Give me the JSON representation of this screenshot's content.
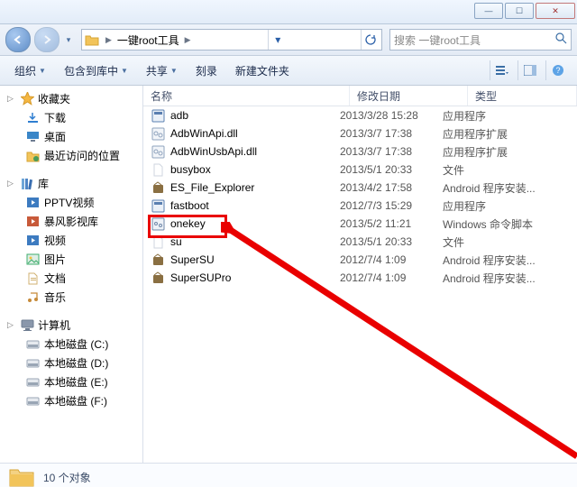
{
  "titlebar": {
    "min": "—",
    "max": "☐",
    "close": "✕"
  },
  "nav": {
    "crumb_text": "一键root工具",
    "search_placeholder": "搜索 一键root工具"
  },
  "toolbar": {
    "organize": "组织",
    "include": "包含到库中",
    "share": "共享",
    "burn": "刻录",
    "newfolder": "新建文件夹"
  },
  "sidebar": {
    "favorites": {
      "label": "收藏夹",
      "items": [
        "下载",
        "桌面",
        "最近访问的位置"
      ]
    },
    "libraries": {
      "label": "库",
      "items": [
        "PPTV视频",
        "暴风影视库",
        "视频",
        "图片",
        "文档",
        "音乐"
      ]
    },
    "computer": {
      "label": "计算机",
      "items": [
        "本地磁盘 (C:)",
        "本地磁盘 (D:)",
        "本地磁盘 (E:)",
        "本地磁盘 (F:)"
      ]
    }
  },
  "columns": {
    "name": "名称",
    "date": "修改日期",
    "type": "类型"
  },
  "files": [
    {
      "name": "adb",
      "date": "2013/3/28 15:28",
      "type": "应用程序",
      "icon": "exe"
    },
    {
      "name": "AdbWinApi.dll",
      "date": "2013/3/7 17:38",
      "type": "应用程序扩展",
      "icon": "dll"
    },
    {
      "name": "AdbWinUsbApi.dll",
      "date": "2013/3/7 17:38",
      "type": "应用程序扩展",
      "icon": "dll"
    },
    {
      "name": "busybox",
      "date": "2013/5/1 20:33",
      "type": "文件",
      "icon": "file"
    },
    {
      "name": "ES_File_Explorer",
      "date": "2013/4/2 17:58",
      "type": "Android 程序安装...",
      "icon": "apk"
    },
    {
      "name": "fastboot",
      "date": "2012/7/3 15:29",
      "type": "应用程序",
      "icon": "exe"
    },
    {
      "name": "onekey",
      "date": "2013/5/2 11:21",
      "type": "Windows 命令脚本",
      "icon": "bat"
    },
    {
      "name": "su",
      "date": "2013/5/1 20:33",
      "type": "文件",
      "icon": "file"
    },
    {
      "name": "SuperSU",
      "date": "2012/7/4 1:09",
      "type": "Android 程序安装...",
      "icon": "apk"
    },
    {
      "name": "SuperSUPro",
      "date": "2012/7/4 1:09",
      "type": "Android 程序安装...",
      "icon": "apk"
    }
  ],
  "status": {
    "count": "10 个对象"
  },
  "icons": {
    "star": "#f5b742",
    "folder": "#f2c45a",
    "folder_edge": "#d6a436",
    "download": "#2f7ed1",
    "desktop": "#3a86c8",
    "recent": "#4a9c5a",
    "lib": "#4f86c6",
    "video": "#3d7bc0",
    "storm": "#c85a3a",
    "pic": "#3fae6d",
    "doc": "#d0b070",
    "music": "#c68b3a",
    "computer": "#6f7d92",
    "disk": "#9aa6b5",
    "exe": "#5a7fb0",
    "dll": "#8fa3bd",
    "file": "#cfd5df",
    "apk": "#8a6f42",
    "bat": "#7088aa"
  }
}
